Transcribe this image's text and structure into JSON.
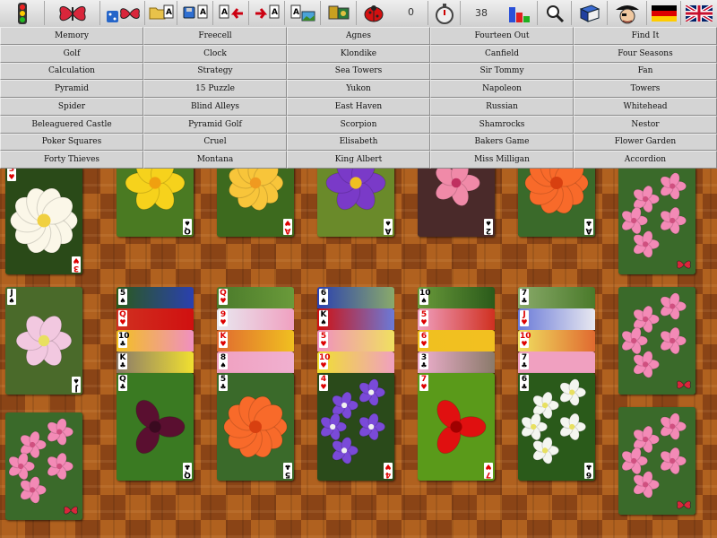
{
  "toolbar": {
    "counter_value": "0",
    "timer_value": "38",
    "icons": [
      "traffic-light-icon",
      "butterfly-icon",
      "dice-butterfly-icon",
      "folder-open-icon",
      "save-icon",
      "undo-icon",
      "redo-icon",
      "folder-image-icon",
      "card-back-icon",
      "ladybug-icon",
      "stopwatch-icon",
      "bar-chart-icon",
      "magnifier-icon",
      "book-icon",
      "pirate-icon",
      "german-flag-icon",
      "uk-flag-icon"
    ]
  },
  "menu": {
    "columns": [
      [
        "Memory",
        "Golf",
        "Calculation",
        "Pyramid",
        "Spider",
        "Beleaguered Castle",
        "Poker Squares",
        "Forty Thieves"
      ],
      [
        "Freecell",
        "Clock",
        "Strategy",
        "15 Puzzle",
        "Blind Alleys",
        "Pyramid Golf",
        "Cruel",
        "Montana"
      ],
      [
        "Agnes",
        "Klondike",
        "Sea Towers",
        "Yukon",
        "East Haven",
        "Scorpion",
        "Elisabeth",
        "King Albert"
      ],
      [
        "Fourteen Out",
        "Canfield",
        "Sir Tommy",
        "Napoleon",
        "Russian",
        "Shamrocks",
        "Bakers Game",
        "Miss Milligan"
      ],
      [
        "Find It",
        "Four Seasons",
        "Fan",
        "Towers",
        "Whitehead",
        "Nestor",
        "Flower Garden",
        "Accordion"
      ]
    ]
  },
  "cards": {
    "foundations": [
      {
        "rank": "Q",
        "suit": "♠",
        "color": "blk",
        "flower": "daffodil"
      },
      {
        "rank": "A",
        "suit": "♥",
        "color": "red",
        "flower": "yellow-rose"
      },
      {
        "rank": "A",
        "suit": "♠",
        "color": "blk",
        "flower": "crocus"
      },
      {
        "rank": "2",
        "suit": "♠",
        "color": "blk",
        "flower": "pink-azalea"
      },
      {
        "rank": "A",
        "suit": "♣",
        "color": "blk",
        "flower": "orange-rose"
      }
    ],
    "left_column": [
      {
        "rank": "3",
        "suit": "♥",
        "color": "red",
        "flower": "water-lily"
      },
      {
        "rank": "J",
        "suit": "♠",
        "color": "blk",
        "flower": "clematis"
      }
    ],
    "tableau": [
      {
        "stack": [
          {
            "rank": "5",
            "suit": "♠",
            "color": "blk"
          },
          {
            "rank": "Q",
            "suit": "♥",
            "color": "red"
          },
          {
            "rank": "10",
            "suit": "♣",
            "color": "blk"
          },
          {
            "rank": "K",
            "suit": "♣",
            "color": "blk"
          }
        ],
        "top": {
          "rank": "Q",
          "suit": "♣",
          "color": "blk",
          "flower": "purple-tulip"
        }
      },
      {
        "stack": [
          {
            "rank": "Q",
            "suit": "♥",
            "color": "red"
          },
          {
            "rank": "9",
            "suit": "♥",
            "color": "red"
          },
          {
            "rank": "K",
            "suit": "♥",
            "color": "red"
          },
          {
            "rank": "8",
            "suit": "♠",
            "color": "blk"
          }
        ],
        "top": {
          "rank": "5",
          "suit": "♣",
          "color": "blk",
          "flower": "orange-rose"
        }
      },
      {
        "stack": [
          {
            "rank": "6",
            "suit": "♠",
            "color": "blk"
          },
          {
            "rank": "K",
            "suit": "♠",
            "color": "blk"
          },
          {
            "rank": "5",
            "suit": "♥",
            "color": "red"
          },
          {
            "rank": "10",
            "suit": "♥",
            "color": "red"
          }
        ],
        "top": {
          "rank": "4",
          "suit": "♥",
          "color": "red",
          "flower": "phlox"
        }
      },
      {
        "stack": [
          {
            "rank": "10",
            "suit": "♠",
            "color": "blk"
          },
          {
            "rank": "5",
            "suit": "♥",
            "color": "red"
          },
          {
            "rank": "6",
            "suit": "♥",
            "color": "red"
          },
          {
            "rank": "3",
            "suit": "♣",
            "color": "blk"
          }
        ],
        "top": {
          "rank": "7",
          "suit": "♥",
          "color": "red",
          "flower": "red-tulip"
        }
      },
      {
        "stack": [
          {
            "rank": "7",
            "suit": "♣",
            "color": "blk"
          },
          {
            "rank": "J",
            "suit": "♥",
            "color": "red"
          },
          {
            "rank": "10",
            "suit": "♥",
            "color": "red"
          },
          {
            "rank": "7",
            "suit": "♣",
            "color": "blk"
          }
        ],
        "top": {
          "rank": "6",
          "suit": "♣",
          "color": "blk",
          "flower": "white-blossom"
        }
      }
    ],
    "right_backs": 3
  }
}
